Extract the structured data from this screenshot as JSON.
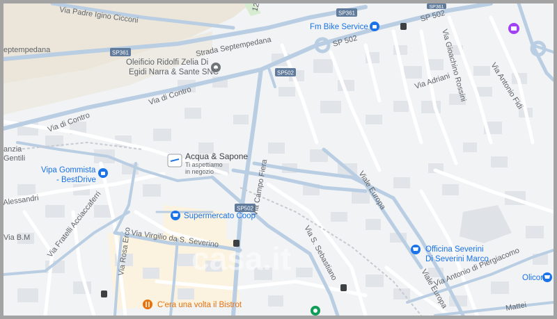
{
  "roads": {
    "via_padre_igino_cicconi": "Via Padre Igino Cicconi",
    "strada_septempedana": "Strada Septempedana",
    "septempedana_left": "eptempedana",
    "sp361_top": "SP361",
    "sp361_left": "SP361",
    "sp502_top": "SP 502",
    "sp502_mid": "SP502",
    "sp502_lower": "SP502",
    "sp502_top2": "SP 502",
    "sp361_corner": "SP361",
    "via_di_contro_1": "Via di Contro",
    "via_di_contro_2": "Via di Contro",
    "via_adriani": "Via Adriani",
    "via_gioachino_rossini": "Via Gioachino Rossini",
    "via_antonio_fidi": "Via Antonio Fidi",
    "via_alessandri": "Alessandri",
    "via_fratelli_acciaccaferri": "Via Fratelli Acciaccaferri",
    "via_virgilio": "Via Virgilio da S. Severino",
    "via_campo_fiera": "Via Campo Fiera",
    "via_s_sebastiano": "Via S. Sebastiano",
    "viale_europa_1": "Viale Europa",
    "viale_europa_2": "Viale Europa",
    "via_antonio_di_piergiacomo": "Via Antonio di Piergiacomo",
    "via_rosa_ercolani": "Via Rosa Erco",
    "via_bm": "Via B.M",
    "via_mattei": "Mattei",
    "label_121": "121"
  },
  "pois": {
    "fm_bike": "Fm Bike Service",
    "oleificio_line1": "Oleificio Ridolfi Zelia Di",
    "oleificio_line2": "Egidi Narra & Sante SNC",
    "acqua_sapone": "Acqua & Sapone",
    "acqua_sapone_sub1": "Ti aspettiamo",
    "acqua_sapone_sub2": "in negozio",
    "vipa_line1": "Vipa Gommista",
    "vipa_line2": "- BestDrive",
    "supermercato": "Supermercato Coop",
    "officina_line1": "Officina Severini",
    "officina_line2": "Di Severini Marco",
    "olicor": "Olicor",
    "bistrot": "C'era una volta il Bistrot",
    "agenzia_line1": "anzia",
    "agenzia_line2": "Gentili"
  },
  "watermark": "casa.it",
  "colors": {
    "background": "#f1f3f4",
    "road": "#ffffff",
    "highway": "#a8c5e0",
    "building": "#e1e4e8",
    "field": "#ebe6d9",
    "commercial": "#fbf3df",
    "poi_blue": "#1a73e8",
    "poi_orange": "#e8710a",
    "poi_purple": "#a142f4",
    "poi_green": "#0f9d58"
  }
}
